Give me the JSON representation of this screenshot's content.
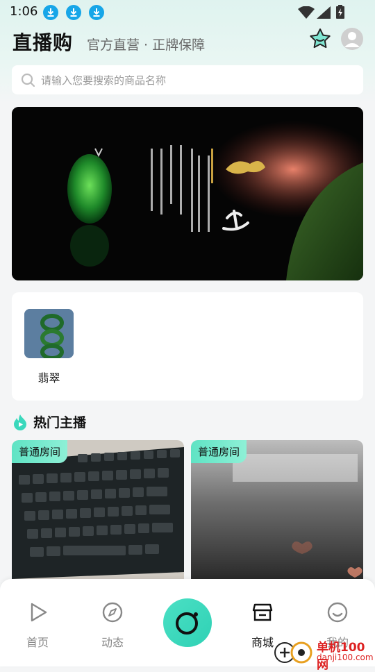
{
  "status_bar": {
    "time": "1:06"
  },
  "header": {
    "title": "直播购",
    "subtitle": "官方直营 · 正牌保障"
  },
  "search": {
    "placeholder": "请输入您要搜索的商品名称"
  },
  "categories": [
    {
      "label": "翡翠"
    }
  ],
  "section": {
    "title": "热门主播"
  },
  "rooms": [
    {
      "badge": "普通房间"
    },
    {
      "badge": "普通房间"
    }
  ],
  "tabbar": {
    "items": [
      {
        "label": "首页",
        "icon": "play-icon"
      },
      {
        "label": "动态",
        "icon": "compass-icon"
      },
      {
        "label": "",
        "icon": "camera-live-icon"
      },
      {
        "label": "商城",
        "icon": "store-icon"
      },
      {
        "label": "我的",
        "icon": "smile-icon"
      }
    ]
  },
  "watermark": {
    "text": "单机100网",
    "url": "danji100.com"
  },
  "colors": {
    "accent": "#3ad8bc",
    "download_badge": "#17a6e8"
  }
}
